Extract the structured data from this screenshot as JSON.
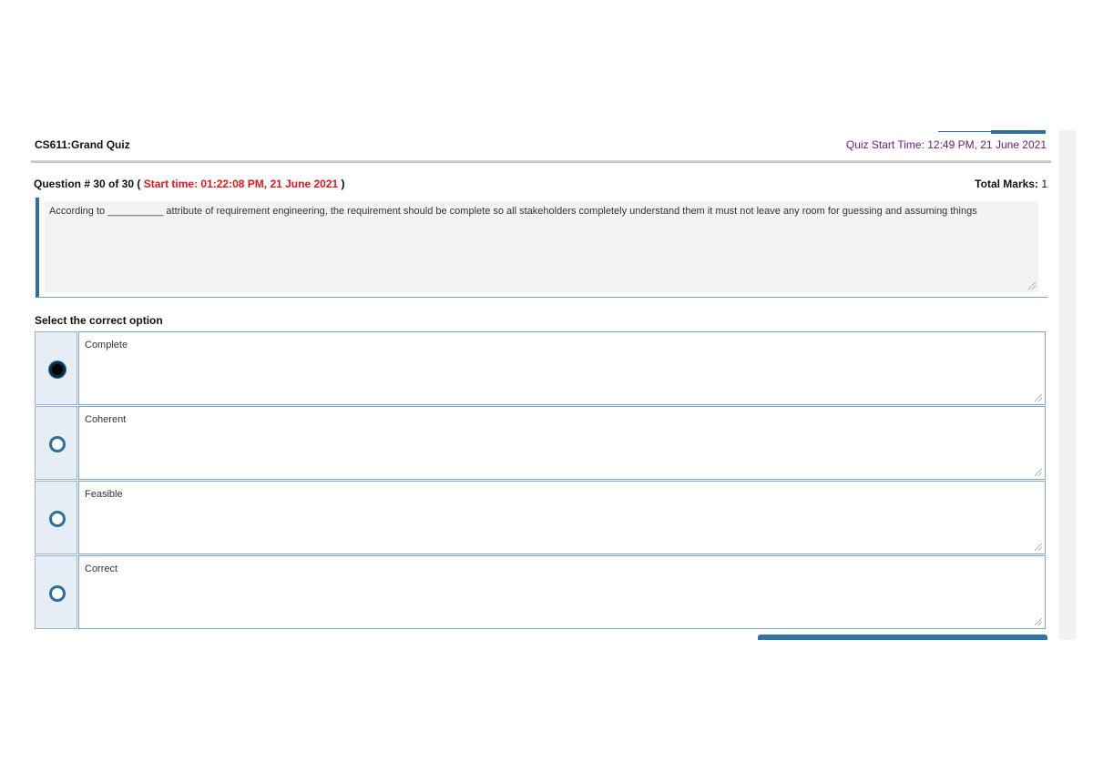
{
  "header": {
    "quiz_title": "CS611:Grand Quiz",
    "quiz_start": "Quiz Start Time: 12:49 PM, 21 June 2021"
  },
  "question": {
    "label": "Question # 30 of 30",
    "open_paren": "(",
    "start_time": "Start time: 01:22:08 PM, 21 June 2021",
    "close_paren": ")",
    "total_marks_label": "Total Marks:",
    "total_marks_value": "1",
    "text": "According to __________ attribute of requirement engineering, the requirement should be complete so all stakeholders completely understand them it must not leave any room for guessing and assuming things"
  },
  "select_label": "Select the correct option",
  "options": [
    {
      "label": "Complete",
      "selected": true
    },
    {
      "label": "Coherent",
      "selected": false
    },
    {
      "label": "Feasible",
      "selected": false
    },
    {
      "label": "Correct",
      "selected": false
    }
  ],
  "colors": {
    "accent": "#2c6e9e",
    "start_time": "#e3161d",
    "quiz_start": "#6a1b7a"
  }
}
